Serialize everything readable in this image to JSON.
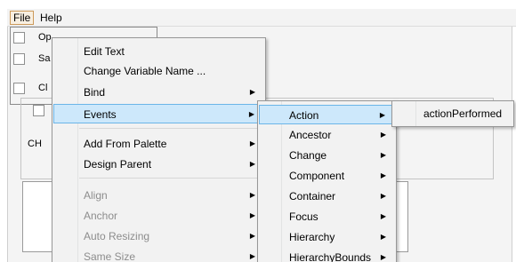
{
  "menubar": {
    "items": [
      {
        "label": "File"
      },
      {
        "label": "Help"
      }
    ]
  },
  "form": {
    "partial_labels": [
      "Op",
      "Sa",
      "Cl",
      "CH"
    ]
  },
  "context_menu": {
    "items": [
      {
        "label": "Edit Text",
        "enabled": true,
        "submenu": false
      },
      {
        "label": "Change Variable Name ...",
        "enabled": true,
        "submenu": false
      },
      {
        "label": "Bind",
        "enabled": true,
        "submenu": true
      },
      {
        "label": "Events",
        "enabled": true,
        "submenu": true,
        "highlighted": true
      },
      {
        "label": "Add From Palette",
        "enabled": true,
        "submenu": true
      },
      {
        "label": "Design Parent",
        "enabled": true,
        "submenu": true
      },
      {
        "label": "Align",
        "enabled": false,
        "submenu": true
      },
      {
        "label": "Anchor",
        "enabled": false,
        "submenu": true
      },
      {
        "label": "Auto Resizing",
        "enabled": false,
        "submenu": true
      },
      {
        "label": "Same Size",
        "enabled": false,
        "submenu": true
      }
    ]
  },
  "events_menu": {
    "items": [
      {
        "label": "Action",
        "highlighted": true
      },
      {
        "label": "Ancestor"
      },
      {
        "label": "Change"
      },
      {
        "label": "Component"
      },
      {
        "label": "Container"
      },
      {
        "label": "Focus"
      },
      {
        "label": "Hierarchy"
      },
      {
        "label": "HierarchyBounds"
      }
    ]
  },
  "action_menu": {
    "items": [
      {
        "label": "actionPerformed"
      }
    ]
  },
  "colors": {
    "menu_background": "#f2f2f2",
    "highlight_fill": "#cde8fb",
    "highlight_border": "#6bb5e8",
    "disabled_text": "#8d8d8d"
  }
}
